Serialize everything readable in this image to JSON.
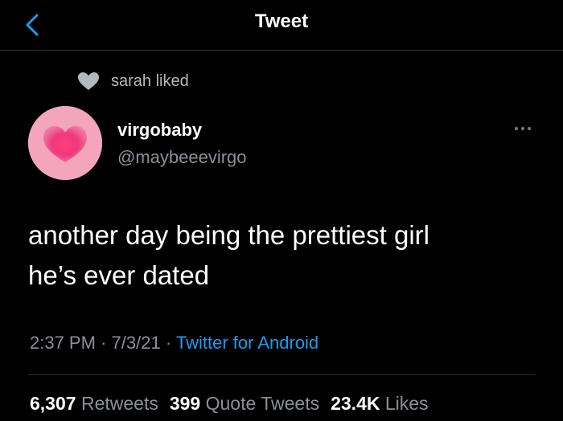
{
  "header": {
    "title": "Tweet",
    "back_icon": "chevron-left-icon"
  },
  "social_context": {
    "icon": "heart-icon",
    "text": "sarah liked"
  },
  "tweet": {
    "author_name": "virgobaby",
    "author_handle": "@maybeeevirgo",
    "text_line1": "another day being the prettiest girl",
    "text_line2": "he’s ever dated",
    "time": "2:37 PM",
    "separator": "·",
    "date": "7/3/21",
    "source": "Twitter for Android"
  },
  "stats": {
    "retweets_count": "6,307",
    "retweets_label": "Retweets",
    "quotes_count": "399",
    "quotes_label": "Quote Tweets",
    "likes_count": "23.4K",
    "likes_label": "Likes"
  },
  "colors": {
    "background": "#000000",
    "accent": "#1d9bf0",
    "secondary_text": "#8b9095",
    "avatar_bg": "#f2a5bd",
    "avatar_heart": "#ee3a7c"
  }
}
